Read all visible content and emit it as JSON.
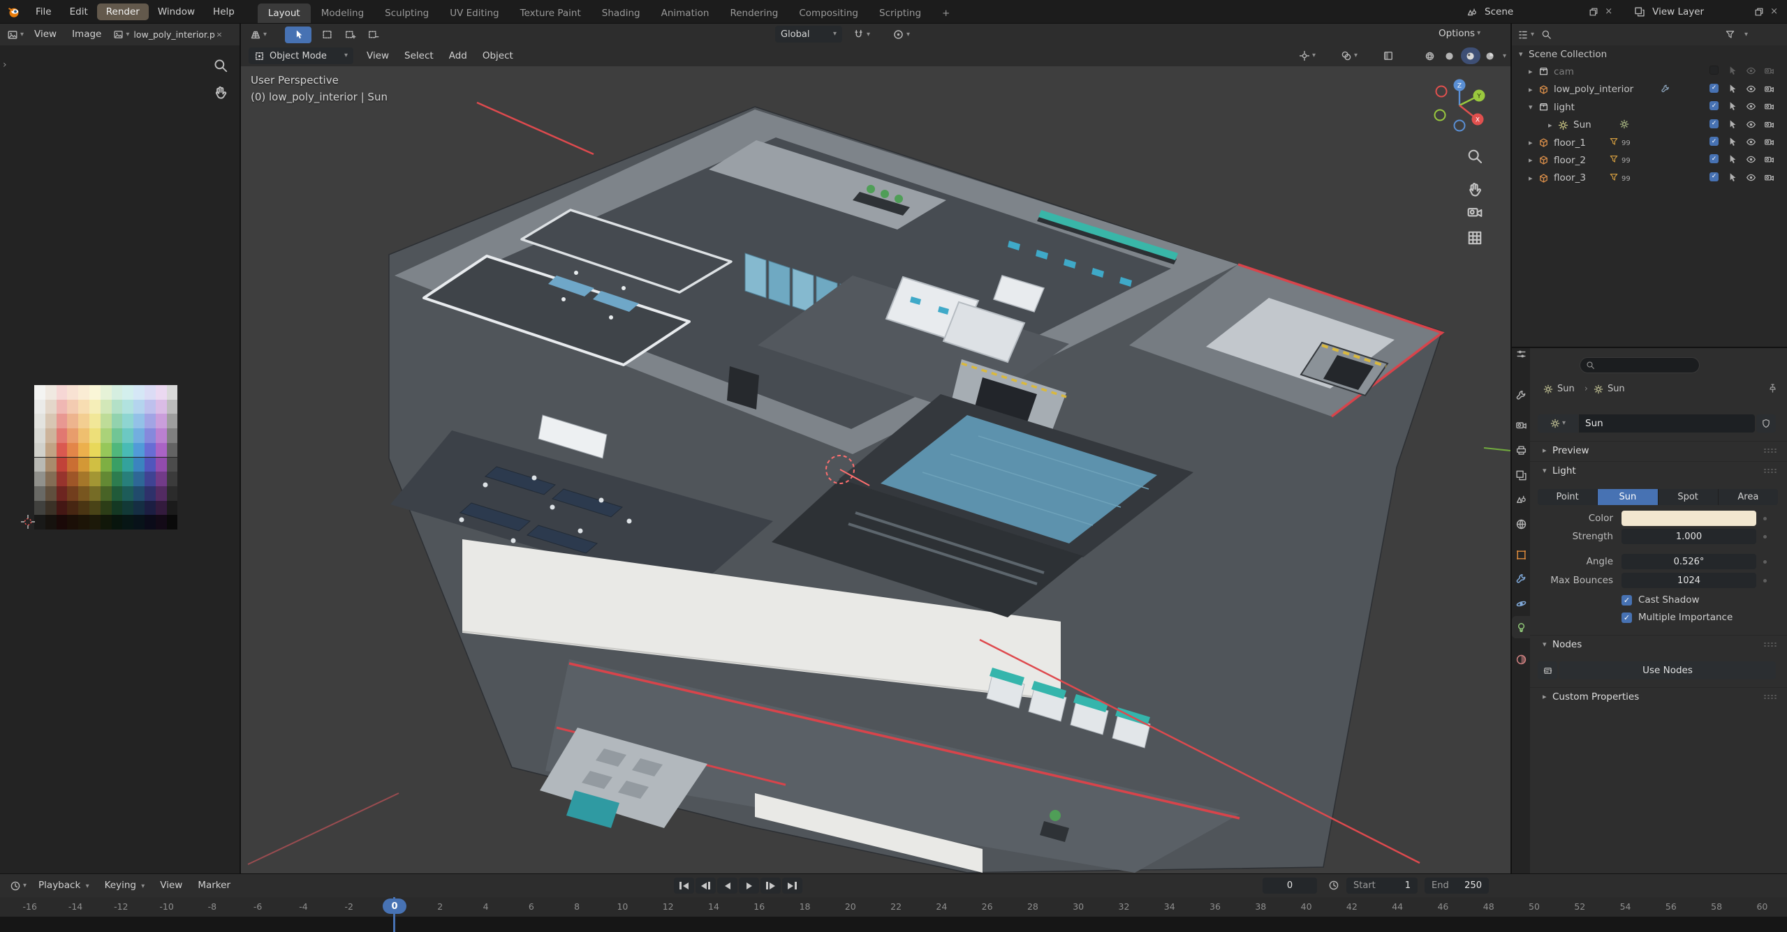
{
  "topbar": {
    "menus": [
      "File",
      "Edit",
      "Render",
      "Window",
      "Help"
    ],
    "active_menu": "Render",
    "workspaces": [
      "Layout",
      "Modeling",
      "Sculpting",
      "UV Editing",
      "Texture Paint",
      "Shading",
      "Animation",
      "Rendering",
      "Compositing",
      "Scripting"
    ],
    "active_workspace": "Layout",
    "new_workspace_label": "+",
    "scene_label": "Scene",
    "view_layer_label": "View Layer"
  },
  "image_editor": {
    "menus": [
      "View",
      "Image"
    ],
    "image_name": "low_poly_interior.p",
    "palette_columns": [
      "#cdcdc6",
      "#bb9a78",
      "#d6493f",
      "#e07a38",
      "#eaa83c",
      "#e6d44a",
      "#8cc24a",
      "#3fb070",
      "#38b4ae",
      "#4192d4",
      "#5a5fd0",
      "#a254c0",
      "#545454"
    ],
    "palette_rows": 10
  },
  "viewport": {
    "mode": "Object Mode",
    "menus": [
      "View",
      "Select",
      "Add",
      "Object"
    ],
    "orientation": "Global",
    "options_label": "Options",
    "overlay_line1": "User Perspective",
    "overlay_line2": "(0) low_poly_interior | Sun"
  },
  "outliner": {
    "root": "Scene Collection",
    "rows": [
      {
        "name": "cam",
        "type": "collection",
        "depth": 1,
        "dimmed": true,
        "expander": "closed"
      },
      {
        "name": "low_poly_interior",
        "type": "object",
        "depth": 1,
        "expander": "closed",
        "badge": "modifier"
      },
      {
        "name": "light",
        "type": "collection",
        "depth": 1,
        "expander": "open"
      },
      {
        "name": "Sun",
        "type": "light",
        "depth": 2,
        "expander": "closed",
        "badge": "light-data"
      },
      {
        "name": "floor_1",
        "type": "object",
        "depth": 1,
        "expander": "closed",
        "badge": "geometry-nodes",
        "badge_text": "99"
      },
      {
        "name": "floor_2",
        "type": "object",
        "depth": 1,
        "expander": "closed",
        "badge": "geometry-nodes",
        "badge_text": "99"
      },
      {
        "name": "floor_3",
        "type": "object",
        "depth": 1,
        "expander": "closed",
        "badge": "geometry-nodes",
        "badge_text": "99"
      }
    ]
  },
  "properties": {
    "breadcrumb": [
      "Sun",
      "Sun"
    ],
    "datablock_name": "Sun",
    "sections": {
      "preview": "Preview",
      "light": "Light",
      "nodes": "Nodes",
      "custom_properties": "Custom Properties"
    },
    "light_types": [
      "Point",
      "Sun",
      "Spot",
      "Area"
    ],
    "active_light_type": "Sun",
    "color_label": "Color",
    "color_value": "#f2e7d0",
    "fields": [
      {
        "label": "Strength",
        "value": "1.000"
      },
      {
        "label": "Angle",
        "value": "0.526°"
      },
      {
        "label": "Max Bounces",
        "value": "1024"
      }
    ],
    "checkboxes": [
      {
        "label": "Cast Shadow",
        "checked": true
      },
      {
        "label": "Multiple Importance",
        "checked": true
      }
    ],
    "use_nodes_label": "Use Nodes"
  },
  "timeline": {
    "menus": [
      "Playback",
      "Keying",
      "View",
      "Marker"
    ],
    "current_frame": "0",
    "start_label": "Start",
    "start_value": "1",
    "end_label": "End",
    "end_value": "250",
    "tick_min": -16,
    "tick_max": 60,
    "tick_step": 2,
    "playhead_frame": 0
  },
  "colors": {
    "accent": "#4772b3",
    "viewport_bg": "#3e3e3e",
    "sun_line": "#de4a4e"
  }
}
